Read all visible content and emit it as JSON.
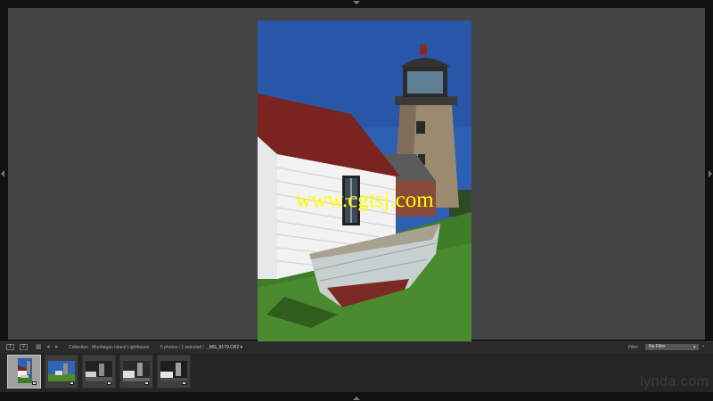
{
  "app": {
    "watermark": "www.cgtsj.com",
    "logo": "lynda.com"
  },
  "panel_toggles": [
    {
      "id": "top",
      "icon": "triangle-down-icon"
    },
    {
      "id": "bottom",
      "icon": "triangle-up-icon"
    },
    {
      "id": "left",
      "icon": "triangle-left-icon"
    },
    {
      "id": "right",
      "icon": "triangle-right-icon"
    }
  ],
  "filmstrip_bar": {
    "monitor_1": "1",
    "monitor_2": "2",
    "grid_icon": "grid-icon",
    "back_icon": "arrow-left-icon",
    "forward_icon": "arrow-right-icon",
    "collection": "Collection : Monhegan Island Lighthouse",
    "photos": "5 photos / 1 selected /",
    "filename": "_MG_9179.CR2",
    "filter_label": "Filter :",
    "filter_value": "No Filter"
  },
  "thumbnails": [
    {
      "name": "lighthouse-boat",
      "selected": true
    },
    {
      "name": "lighthouse-wide",
      "selected": false
    },
    {
      "name": "lighthouse-bw-1",
      "selected": false
    },
    {
      "name": "lighthouse-bw-2",
      "selected": false
    },
    {
      "name": "lighthouse-bw-3",
      "selected": false
    }
  ],
  "colors": {
    "sky": "#2a5db0",
    "grass": "#3f7d28",
    "roof": "#7a2320",
    "stone": "#9c8a70",
    "accent_yellow": "#ffff00"
  }
}
